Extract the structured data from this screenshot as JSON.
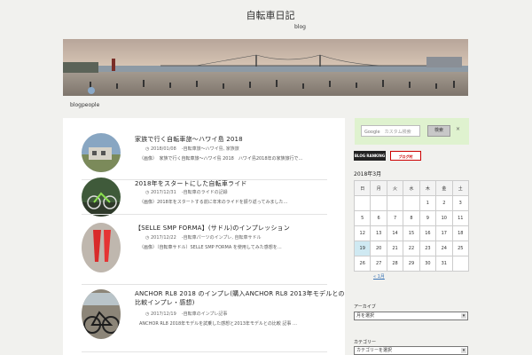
{
  "header": {
    "site_title": "自転車日記",
    "site_description": "blog",
    "blogpeople_link": "blogpeople"
  },
  "posts": [
    {
      "title": "家族で行く自転車旅〜ハワイ島 2018",
      "date": "2018/01/08",
      "tags": "-自転車旅〜ハワイ島, 家族旅",
      "excerpt": "（画像）　家族で行く自転車旅〜ハワイ島 2018　ハワイ島2018年の家族旅行で…"
    },
    {
      "title": "2018年をスタートにした自転車ライド",
      "date": "2017/12/31",
      "tags": "-自転車のライドの記録",
      "excerpt": "（画像）2018年をスタートする前に年末のライドを振り返ってみました…"
    },
    {
      "title": "【SELLE SMP FORMA】(サドル)のインプレッション",
      "date": "2017/12/22",
      "tags": "-自転車パーツのインプレ, 自転車サドル",
      "excerpt": "（画像）（自転車サドル）SELLE SMP FORMA を使用してみた感想を…"
    },
    {
      "title": "ANCHOR RL8 2018 のインプレ(購入ANCHOR RL8 2013年モデルとの比較インプレ)",
      "title_line1": "ANCHOR RL8 2018 のインプレ(購入ANCHOR RL8 2013年モデルとの",
      "title_line2": "比較インプレ・感想)",
      "date": "2017/12/19",
      "tags": "-自転車のインプレ記事",
      "excerpt": "ANCHOR RL8 2018年モデルを試乗した感想と2013年モデルとの比較 記事 …"
    }
  ],
  "search": {
    "google_label": "Google",
    "placeholder": "カスタム検索",
    "button_label": "検索",
    "clear_label": "×"
  },
  "badges": {
    "blog_ranking": "BLOG RANKING",
    "blog_mura": "ブログ村"
  },
  "calendar": {
    "caption": "2018年3月",
    "weekdays": [
      "日",
      "月",
      "火",
      "水",
      "木",
      "金",
      "土"
    ],
    "weeks": [
      [
        "",
        "",
        "",
        "",
        "1",
        "2",
        "3"
      ],
      [
        "5",
        "6",
        "7",
        "8",
        "9",
        "10",
        "11"
      ],
      [
        "12",
        "13",
        "14",
        "15",
        "16",
        "17",
        "18"
      ],
      [
        "19",
        "20",
        "21",
        "22",
        "23",
        "24",
        "25"
      ],
      [
        "26",
        "27",
        "28",
        "29",
        "30",
        "31",
        ""
      ]
    ],
    "today": "19",
    "prev_link": "« 1月"
  },
  "widgets": {
    "archive_label": "アーカイブ",
    "archive_select": "月を選択",
    "category_label": "カテゴリー",
    "category_select": "カテゴリーを選択"
  },
  "colors": {
    "page_bg": "#f1f1ee",
    "search_bg": "#dff2cf",
    "today_bg": "#cfe9f2",
    "link": "#3a74b6"
  }
}
